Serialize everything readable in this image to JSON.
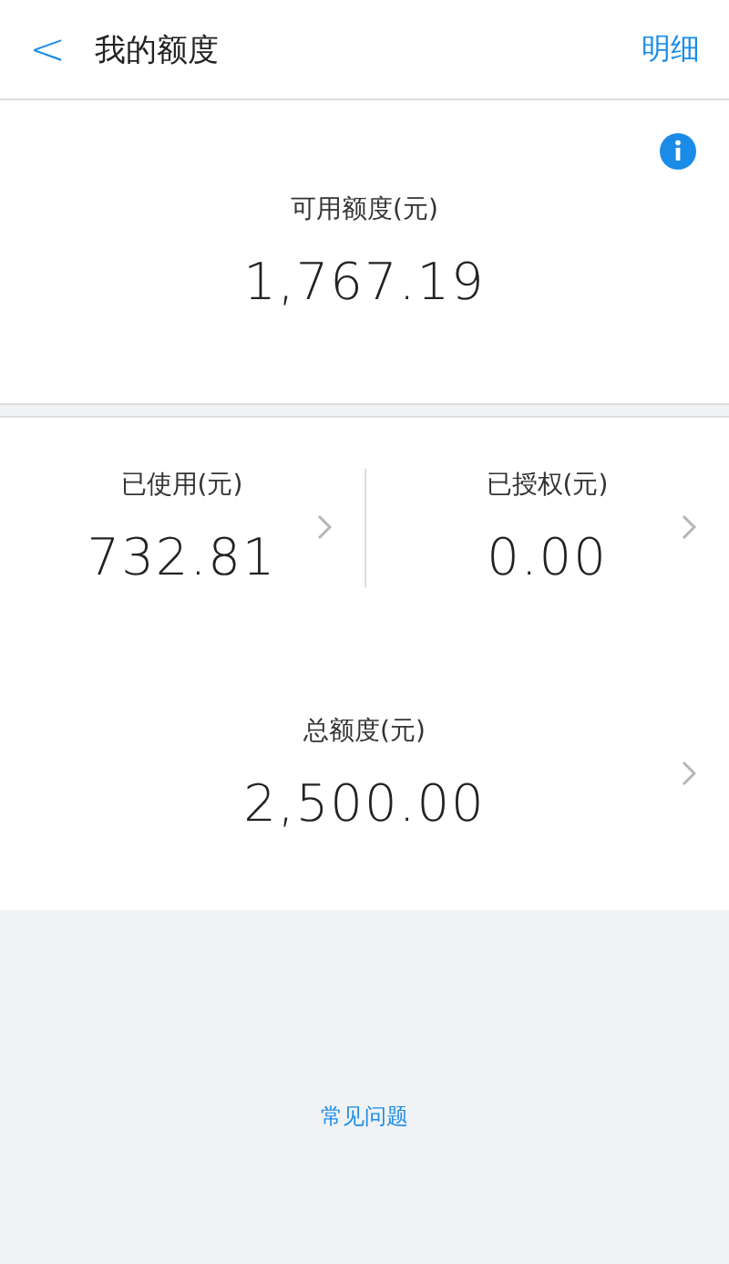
{
  "header": {
    "back": "<",
    "title": "我的额度",
    "action": "明细"
  },
  "available": {
    "label": "可用额度(元)",
    "value": "1,767.19"
  },
  "stats": [
    {
      "label": "已使用(元)",
      "value": "732.81"
    },
    {
      "label": "已授权(元)",
      "value": "0.00"
    }
  ],
  "total": {
    "label": "总额度(元)",
    "value": "2,500.00"
  },
  "faq_link": "常见问题"
}
